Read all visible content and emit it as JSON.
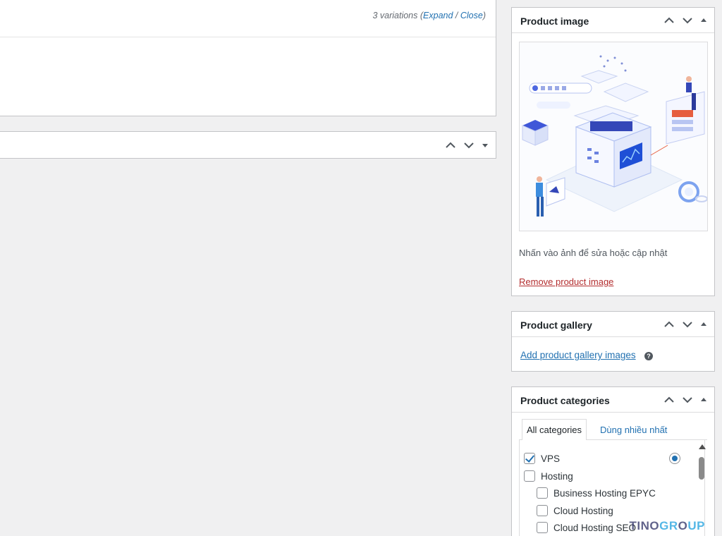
{
  "variations": {
    "count_label": "3 variations",
    "open_paren": " (",
    "expand_label": "Expand",
    "separator": " / ",
    "close_label": "Close",
    "close_paren": ")"
  },
  "product_image": {
    "title": "Product image",
    "hint": "Nhấn vào ảnh để sửa hoặc cập nhật",
    "remove_label": "Remove product image"
  },
  "product_gallery": {
    "title": "Product gallery",
    "add_label": "Add product gallery images",
    "help_glyph": "?"
  },
  "product_categories": {
    "title": "Product categories",
    "tabs": [
      {
        "label": "All categories",
        "active": true
      },
      {
        "label": "Dùng nhiều nhất",
        "active": false
      }
    ],
    "items": [
      {
        "label": "VPS",
        "checked": true
      },
      {
        "label": "Hosting",
        "checked": false
      },
      {
        "label": "Business Hosting EPYC",
        "checked": false
      },
      {
        "label": "Cloud Hosting",
        "checked": false
      },
      {
        "label": "Cloud Hosting SEO",
        "checked": false
      }
    ]
  },
  "watermark": {
    "part1": "TINO",
    "part2": "GR",
    "part3": "O",
    "part4": "UP"
  },
  "colors": {
    "link": "#2271b1",
    "danger": "#b32d2e",
    "background": "#f0f0f1",
    "border": "#c3c4c7"
  },
  "icons": [
    "chevron-up-icon",
    "chevron-down-icon",
    "toggle-arrow-icon",
    "help-icon",
    "checkmark-icon",
    "radio-dot-icon"
  ]
}
